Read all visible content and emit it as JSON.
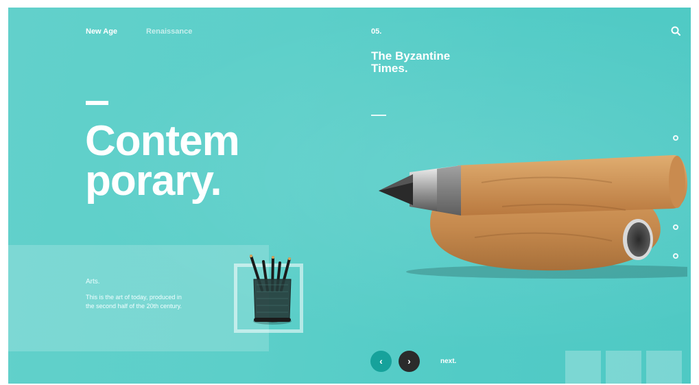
{
  "nav": {
    "item1": "New Age",
    "item2": "Renaissance"
  },
  "hero": {
    "line1": "Contem",
    "line2": "porary."
  },
  "arts": {
    "title": "Arts.",
    "description": "This is the art of today, produced in the second half of the 20th century."
  },
  "feature": {
    "issue": "05.",
    "title": "The Byzantine Times."
  },
  "pager": {
    "prev_icon": "chevron-left-icon",
    "next_icon": "chevron-right-icon",
    "next_label": "next."
  },
  "slides": {
    "count": 5,
    "active_index": 3
  },
  "colors": {
    "background": "#5ccfc9",
    "prev_button": "#16a29b",
    "next_button": "#2b2b2b",
    "wood": "#c68a4e"
  }
}
